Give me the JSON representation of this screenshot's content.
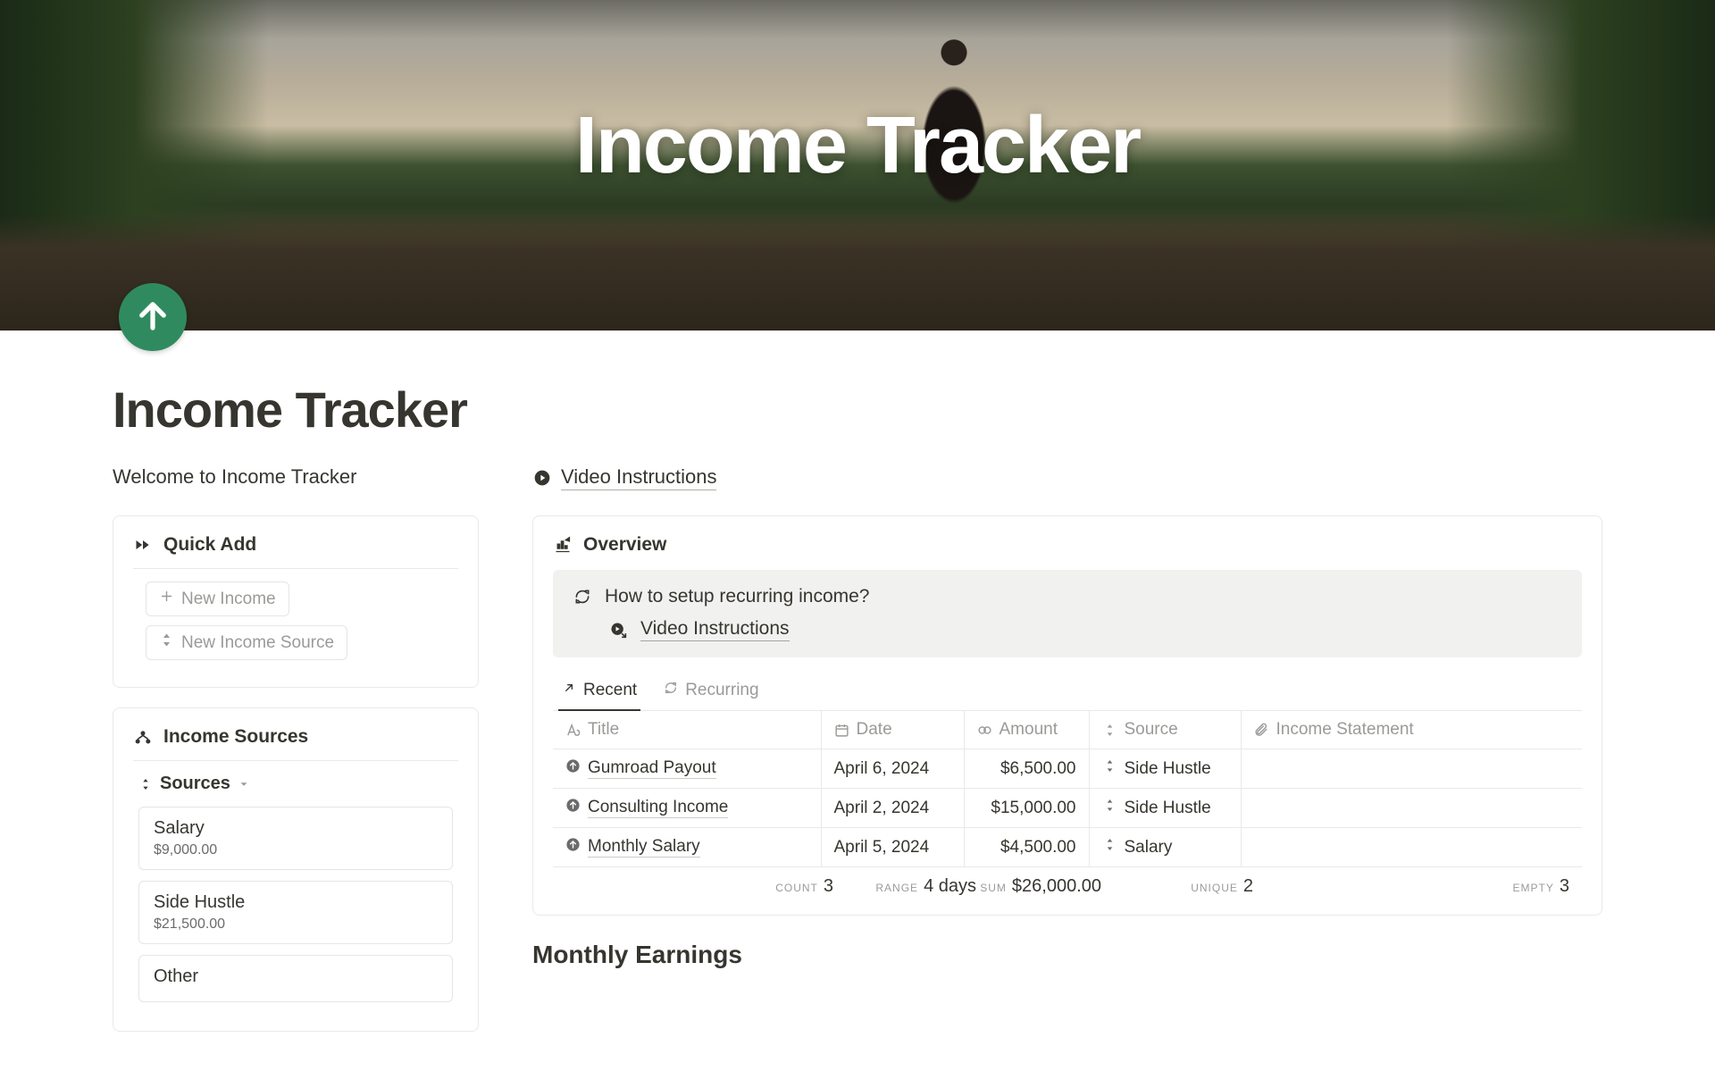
{
  "cover": {
    "title": "Income Tracker"
  },
  "page": {
    "title": "Income Tracker",
    "welcome": "Welcome to Income Tracker",
    "video_link": "Video Instructions"
  },
  "quick_add": {
    "heading": "Quick Add",
    "new_income": "New Income",
    "new_source": "New Income Source"
  },
  "income_sources": {
    "heading": "Income Sources",
    "sources_label": "Sources",
    "items": [
      {
        "name": "Salary",
        "amount": "$9,000.00"
      },
      {
        "name": "Side Hustle",
        "amount": "$21,500.00"
      },
      {
        "name": "Other",
        "amount": ""
      }
    ]
  },
  "overview": {
    "heading": "Overview",
    "callout_question": "How to setup recurring income?",
    "callout_link": "Video Instructions",
    "tabs": {
      "recent": "Recent",
      "recurring": "Recurring"
    },
    "columns": {
      "title": "Title",
      "date": "Date",
      "amount": "Amount",
      "source": "Source",
      "statement": "Income Statement"
    },
    "rows": [
      {
        "title": "Gumroad Payout",
        "date": "April 6, 2024",
        "amount": "$6,500.00",
        "source": "Side Hustle"
      },
      {
        "title": "Consulting Income",
        "date": "April 2, 2024",
        "amount": "$15,000.00",
        "source": "Side Hustle"
      },
      {
        "title": "Monthly Salary",
        "date": "April 5, 2024",
        "amount": "$4,500.00",
        "source": "Salary"
      }
    ],
    "agg": {
      "count_label": "COUNT",
      "count_value": "3",
      "range_label": "RANGE",
      "range_value": "4 days",
      "sum_label": "SUM",
      "sum_value": "$26,000.00",
      "unique_label": "UNIQUE",
      "unique_value": "2",
      "empty_label": "EMPTY",
      "empty_value": "3"
    }
  },
  "monthly_heading": "Monthly Earnings"
}
